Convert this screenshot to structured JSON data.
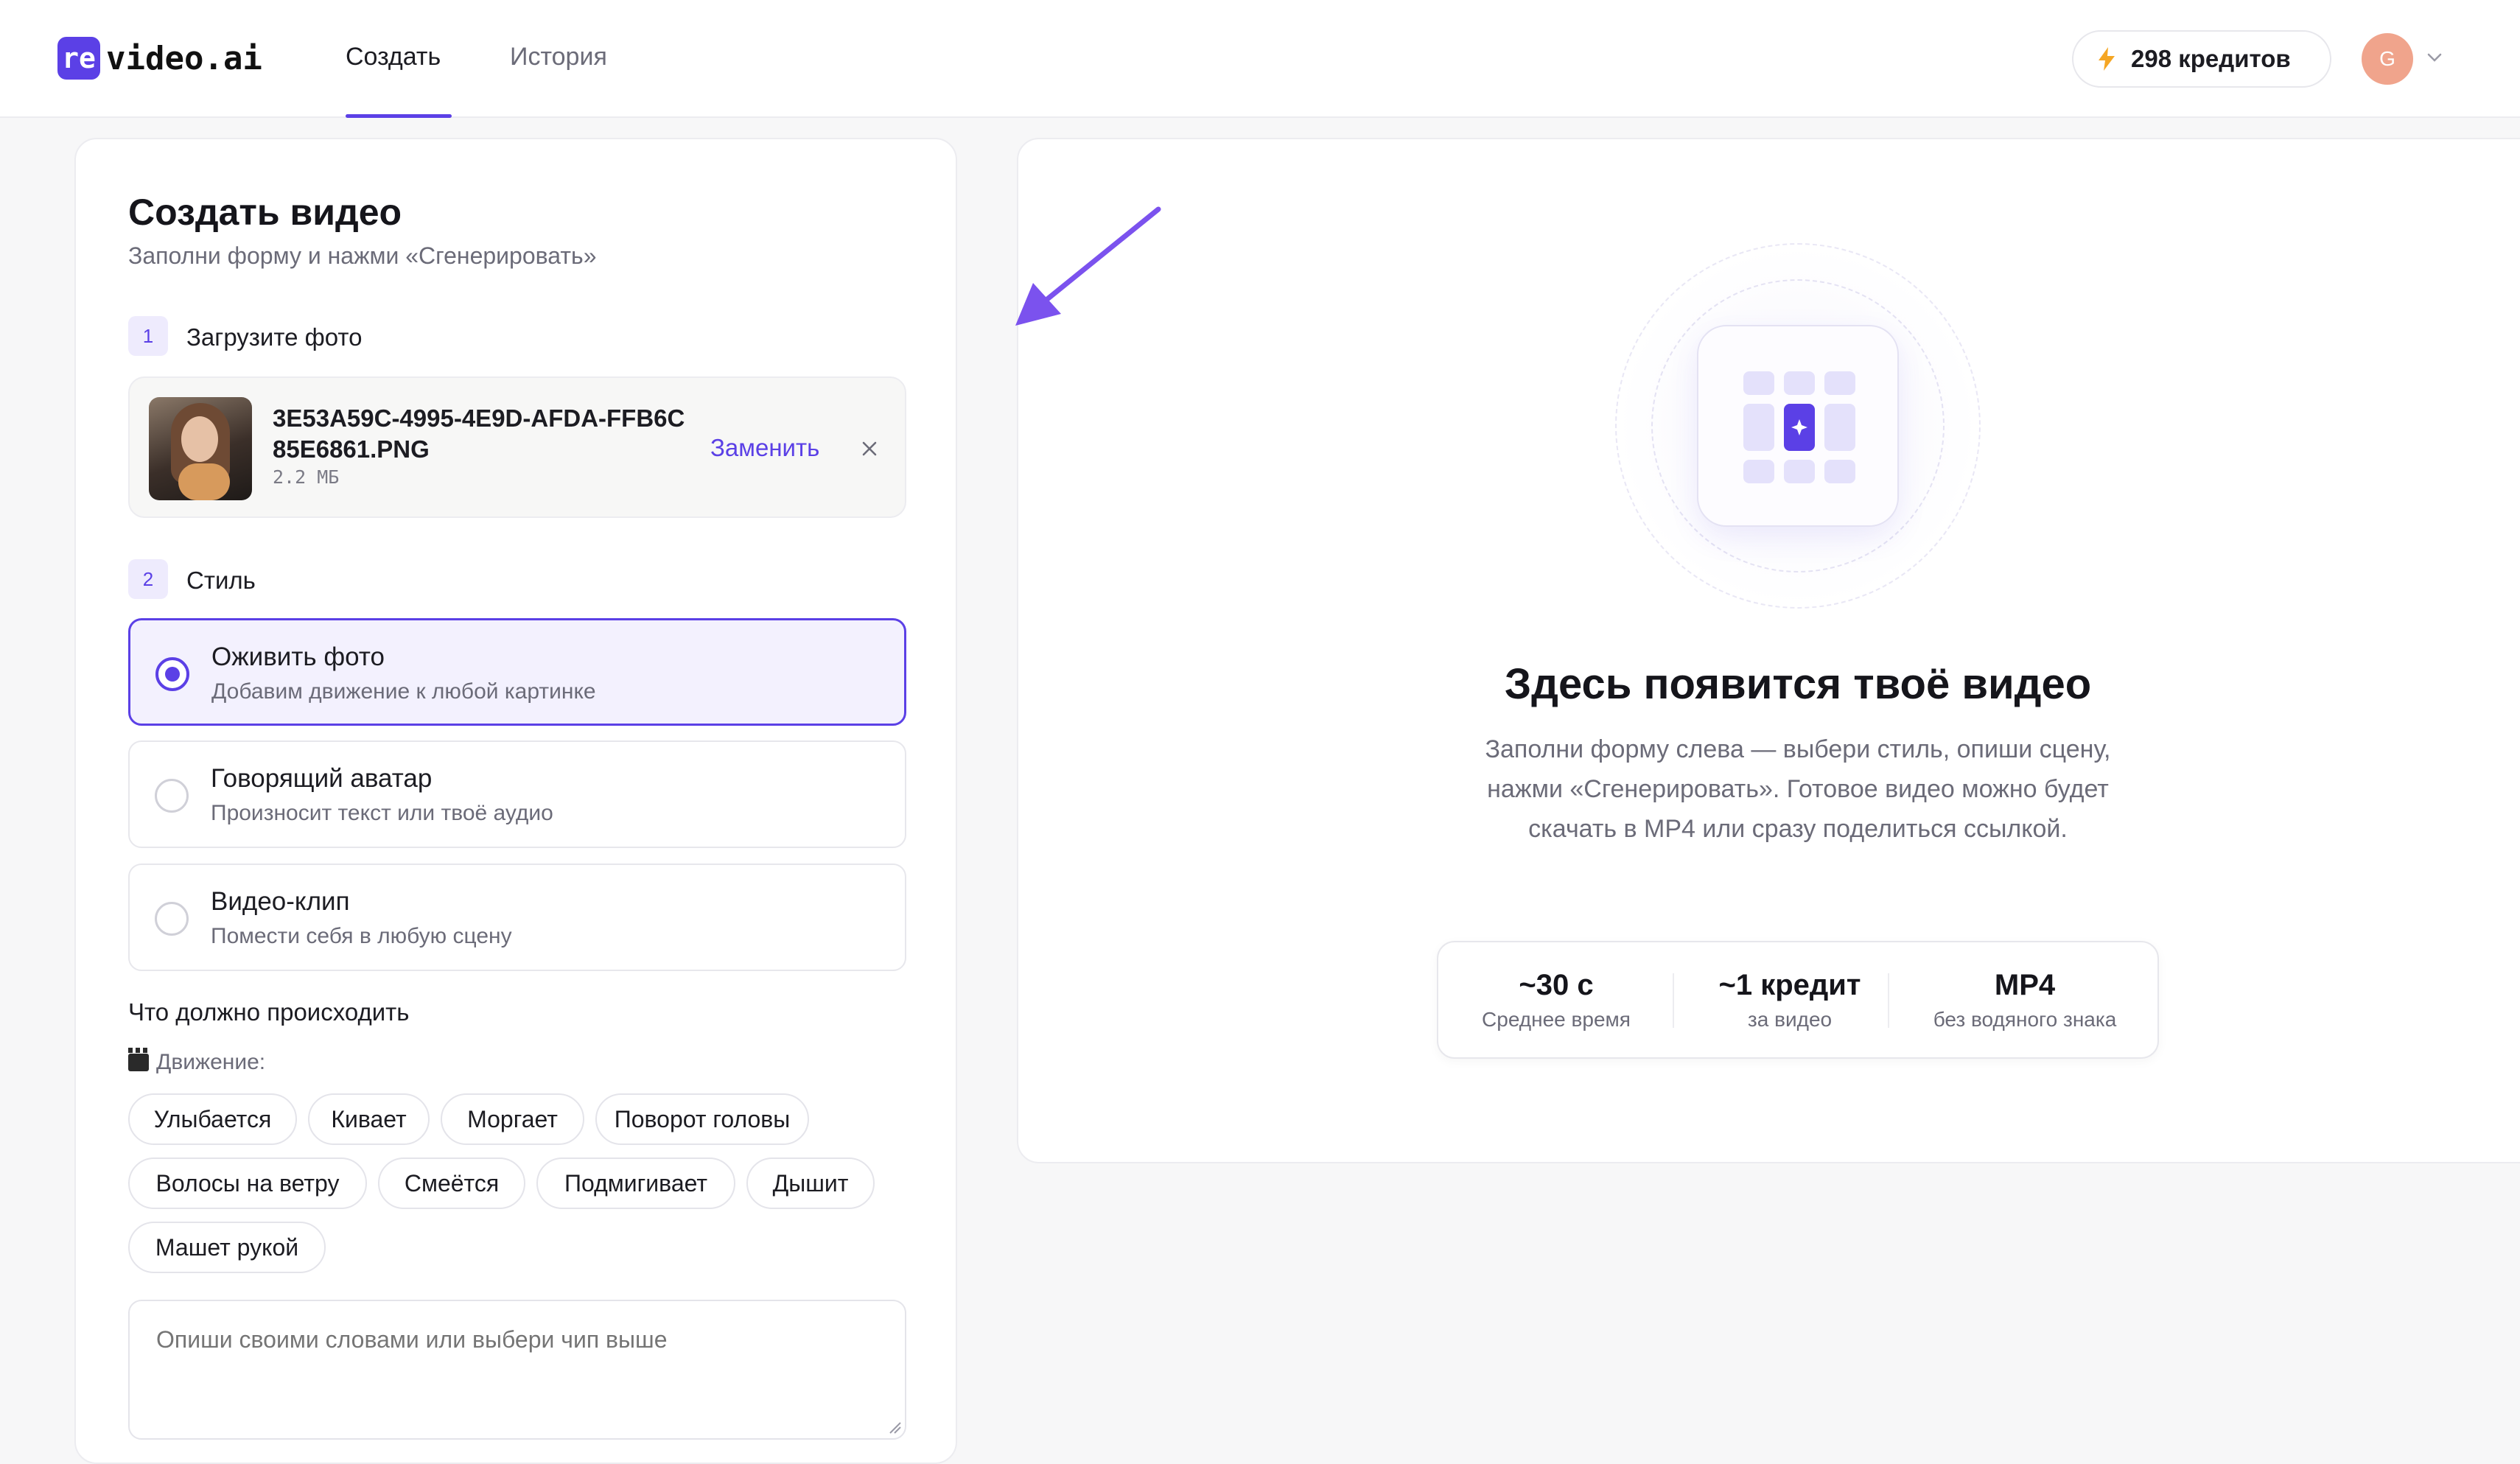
{
  "header": {
    "logo_mark": "re",
    "logo_text": "video.ai",
    "tabs": [
      {
        "label": "Создать",
        "active": true
      },
      {
        "label": "История",
        "active": false
      }
    ],
    "credits": "298 кредитов",
    "avatar_initial": "G"
  },
  "form": {
    "title": "Создать видео",
    "subtitle": "Заполни форму и нажми «Сгенерировать»",
    "step1": {
      "num": "1",
      "label": "Загрузите фото"
    },
    "upload": {
      "file_name": "3E53A59C-4995-4E9D-AFDA-FFB6C85E6861.PNG",
      "file_size": "2.2 МБ",
      "replace_label": "Заменить"
    },
    "step2": {
      "num": "2",
      "label": "Стиль"
    },
    "styles": [
      {
        "title": "Оживить фото",
        "desc": "Добавим движение к любой картинке",
        "selected": true
      },
      {
        "title": "Говорящий аватар",
        "desc": "Произносит текст или твоё аудио",
        "selected": false
      },
      {
        "title": "Видео-клип",
        "desc": "Помести себя в любую сцену",
        "selected": false
      }
    ],
    "what_label": "Что должно происходить",
    "motion_label": "Движение:",
    "chips": [
      "Улыбается",
      "Кивает",
      "Моргает",
      "Поворот головы",
      "Волосы на ветру",
      "Смеётся",
      "Подмигивает",
      "Дышит",
      "Машет рукой"
    ],
    "prompt_placeholder": "Опиши своими словами или выбери чип выше"
  },
  "preview": {
    "title": "Здесь появится твоё видео",
    "description": "Заполни форму слева — выбери стиль, опиши сцену, нажми «Сгенерировать». Готовое видео можно будет скачать в MP4 или сразу поделиться ссылкой.",
    "stats": [
      {
        "value": "~30 с",
        "label": "Среднее время"
      },
      {
        "value": "~1 кредит",
        "label": "за видео"
      },
      {
        "value": "MP4",
        "label": "без водяного знака"
      }
    ]
  },
  "colors": {
    "accent": "#5b40e6",
    "credits_icon": "#f5a623",
    "avatar": "#f0a48c"
  }
}
